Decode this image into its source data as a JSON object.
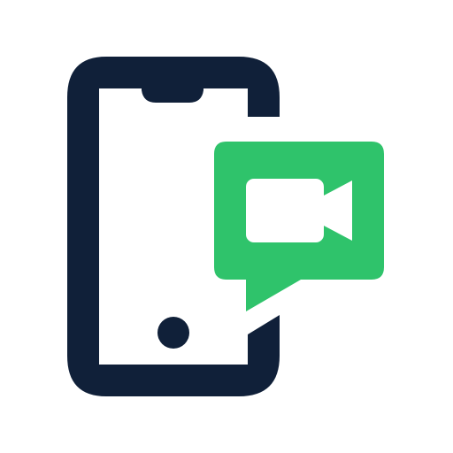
{
  "icon": {
    "name": "mobile-video-call-icon",
    "colors": {
      "phone": "#102039",
      "bubble": "#2fc36b",
      "camera": "#ffffff",
      "background": "#ffffff"
    }
  }
}
